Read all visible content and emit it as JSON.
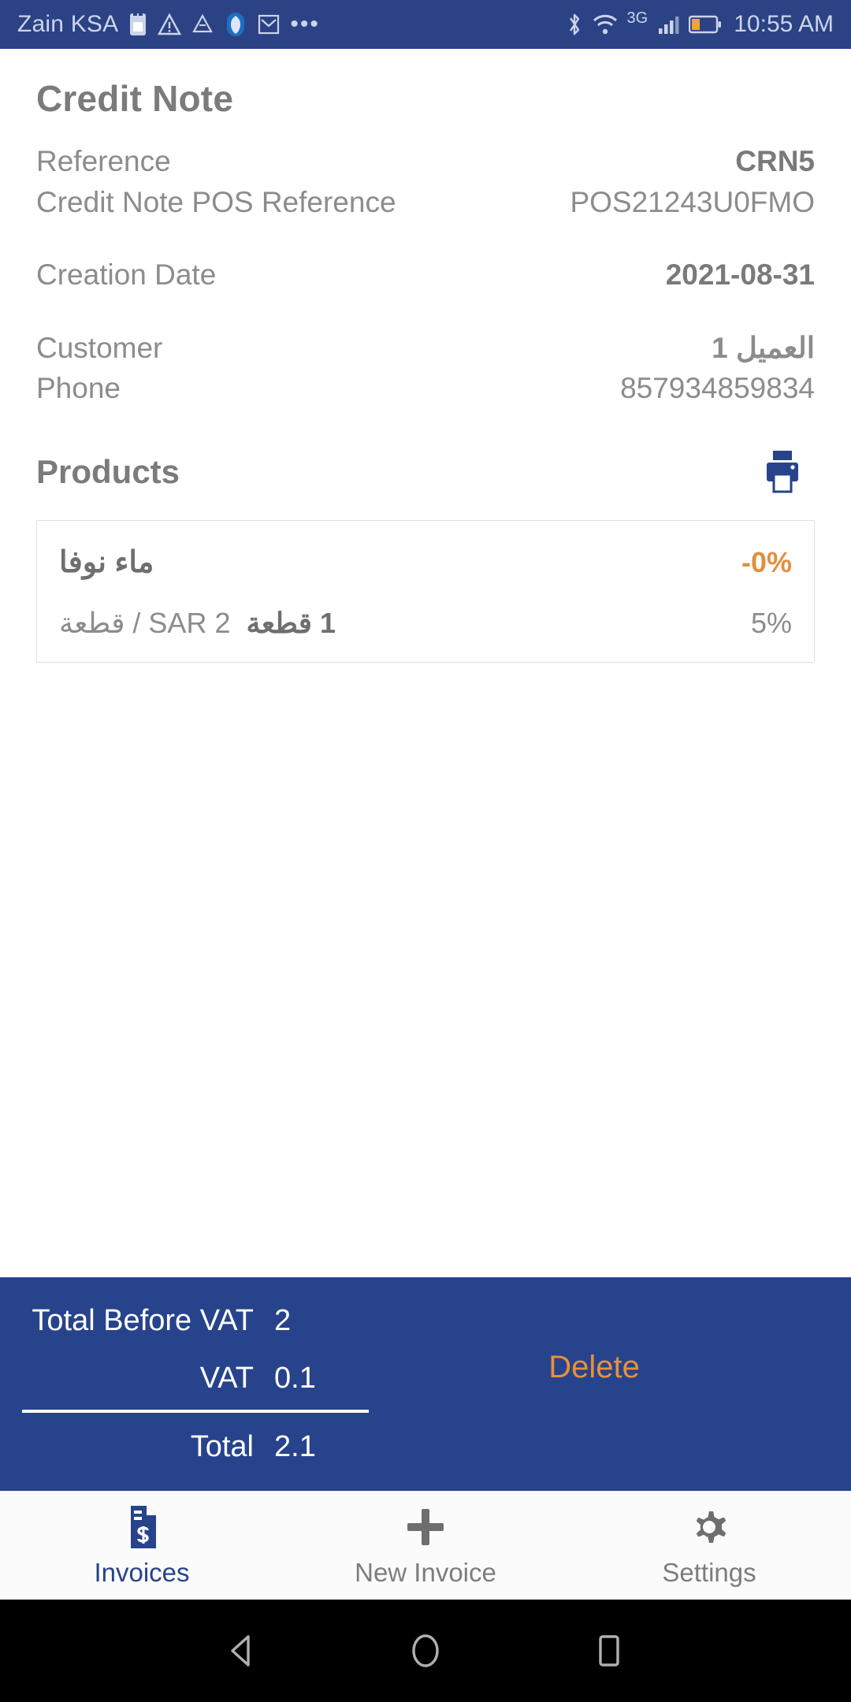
{
  "status_bar": {
    "carrier": "Zain KSA",
    "time": "10:55 AM",
    "overflow_dots": "•••",
    "network_type": "3G",
    "icons": [
      "sim-card-icon",
      "warning-icon",
      "drive-icon",
      "shield-icon",
      "gmail-icon",
      "bluetooth-icon",
      "wifi-icon",
      "signal-icon",
      "battery-icon"
    ],
    "background": "#2b4284",
    "foreground": "#ccd4ec"
  },
  "page": {
    "title": "Credit Note"
  },
  "details": [
    {
      "label": "Reference",
      "value": "CRN5",
      "bold": true
    },
    {
      "label": "Credit Note POS Reference",
      "value": "POS21243U0FMO",
      "bold": false
    },
    {
      "label": "Creation Date",
      "value": "2021-08-31",
      "bold": true
    },
    {
      "label": "Customer",
      "value": "العميل 1",
      "bold": true
    },
    {
      "label": "Phone",
      "value": "857934859834",
      "bold": false
    }
  ],
  "products_section": {
    "title": "Products",
    "print_icon": "print-icon",
    "items": [
      {
        "name": "ماء نوفا",
        "discount": "-0%",
        "quantity_text": "1 قطعة",
        "unit_price_text": "2 SAR / قطعة",
        "vat_rate": "5%"
      }
    ]
  },
  "totals": {
    "before_vat_label": "Total Before VAT",
    "before_vat_value": "2",
    "vat_label": "VAT",
    "vat_value": "0.1",
    "total_label": "Total",
    "total_value": "2.1",
    "delete_label": "Delete",
    "panel_color": "#27438c",
    "delete_color": "#e8903a"
  },
  "bottom_nav": {
    "items": [
      {
        "label": "Invoices",
        "icon": "invoice-dollar-icon",
        "active": true
      },
      {
        "label": "New Invoice",
        "icon": "plus-icon",
        "active": false
      },
      {
        "label": "Settings",
        "icon": "gear-icon",
        "active": false
      }
    ],
    "active_color": "#27438c",
    "inactive_color": "#7d7d7d"
  },
  "android_nav": {
    "back": "back-triangle-icon",
    "home": "home-circle-icon",
    "recents": "recents-square-icon"
  }
}
